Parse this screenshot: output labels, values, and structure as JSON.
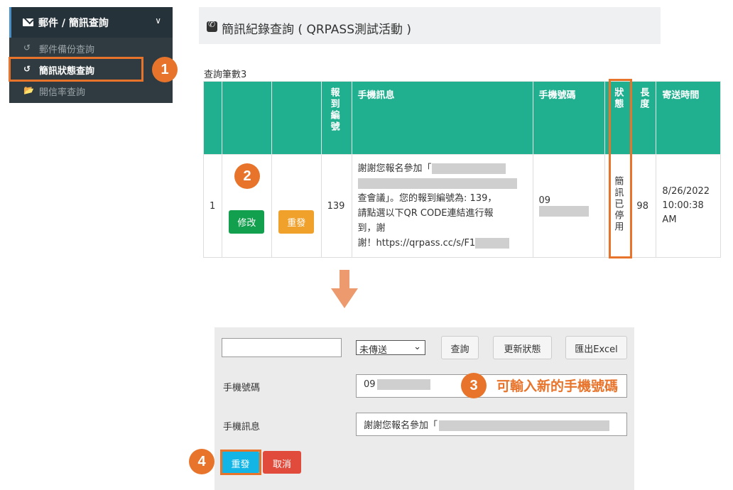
{
  "sidebar": {
    "header": "郵件 / 簡訊查詢",
    "items": [
      {
        "icon": "history-icon",
        "label": "郵件備份查詢"
      },
      {
        "icon": "history-icon",
        "label": "簡訊狀態查詢"
      },
      {
        "icon": "folder-open-icon",
        "label": "開信率查詢"
      }
    ]
  },
  "badges": [
    "1",
    "2",
    "3",
    "4"
  ],
  "page_title": "簡訊紀錄查詢 ( QRPASS測試活動 )",
  "count_label": "查詢筆數3",
  "table": {
    "headers": [
      "",
      "",
      "",
      "報到編號",
      "手機訊息",
      "手機號碼",
      "狀態",
      "長度",
      "寄送時間"
    ],
    "row": {
      "index": "1",
      "edit_label": "修改",
      "resend_label": "重發",
      "checkin_no": "139",
      "message_lines": [
        "謝謝您報名參加「",
        "",
        "查會議」。您的報到編號為: 139，",
        "請點選以下QR CODE連結進行報",
        "到，謝",
        "謝！https://qrpass.cc/s/F1"
      ],
      "phone_prefix": "09",
      "status": "簡訊已停用",
      "length": "98",
      "sent_time": "8/26/2022 10:00:38 AM"
    }
  },
  "form": {
    "search_value": "",
    "status_select": "未傳送",
    "query_label": "查詢",
    "update_label": "更新狀態",
    "export_label": "匯出Excel",
    "phone_label": "手機號碼",
    "phone_value": "09",
    "hint": "可輸入新的手機號碼",
    "message_label": "手機訊息",
    "message_value": "謝謝您報名參加「",
    "resend_label": "重發",
    "cancel_label": "取消"
  },
  "colors": {
    "accent_orange": "#e8742b",
    "table_header": "#20b090",
    "sidebar_bg": "#2f3b40"
  }
}
